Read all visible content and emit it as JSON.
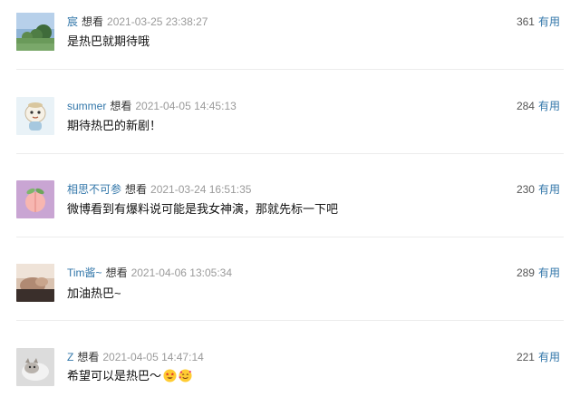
{
  "comments": [
    {
      "username": "宸",
      "status": "想看",
      "time": "2021-03-25 23:38:27",
      "text": "是热巴就期待哦",
      "votes": "361",
      "useful_label": "有用",
      "avatar_icon": "landscape-photo-avatar"
    },
    {
      "username": "summer",
      "status": "想看",
      "time": "2021-04-05 14:45:13",
      "text": "期待热巴的新剧！",
      "votes": "284",
      "useful_label": "有用",
      "avatar_icon": "cartoon-avatar"
    },
    {
      "username": "相思不可参",
      "status": "想看",
      "time": "2021-03-24 16:51:35",
      "text": "微博看到有爆料说可能是我女神演，那就先标一下吧",
      "votes": "230",
      "useful_label": "有用",
      "avatar_icon": "peach-avatar"
    },
    {
      "username": "Tim酱~",
      "status": "想看",
      "time": "2021-04-06 13:05:34",
      "text": "加油热巴~",
      "votes": "289",
      "useful_label": "有用",
      "avatar_icon": "photo-avatar"
    },
    {
      "username": "Z",
      "status": "想看",
      "time": "2021-04-05 14:47:14",
      "text": "希望可以是热巴～",
      "votes": "221",
      "useful_label": "有用",
      "avatar_icon": "cat-photo-avatar",
      "emojis": [
        "star-struck-emoji",
        "smiling-hearts-emoji"
      ]
    }
  ],
  "colors": {
    "link": "#3377aa",
    "time": "#9a9a9a",
    "divider": "#ececec"
  }
}
